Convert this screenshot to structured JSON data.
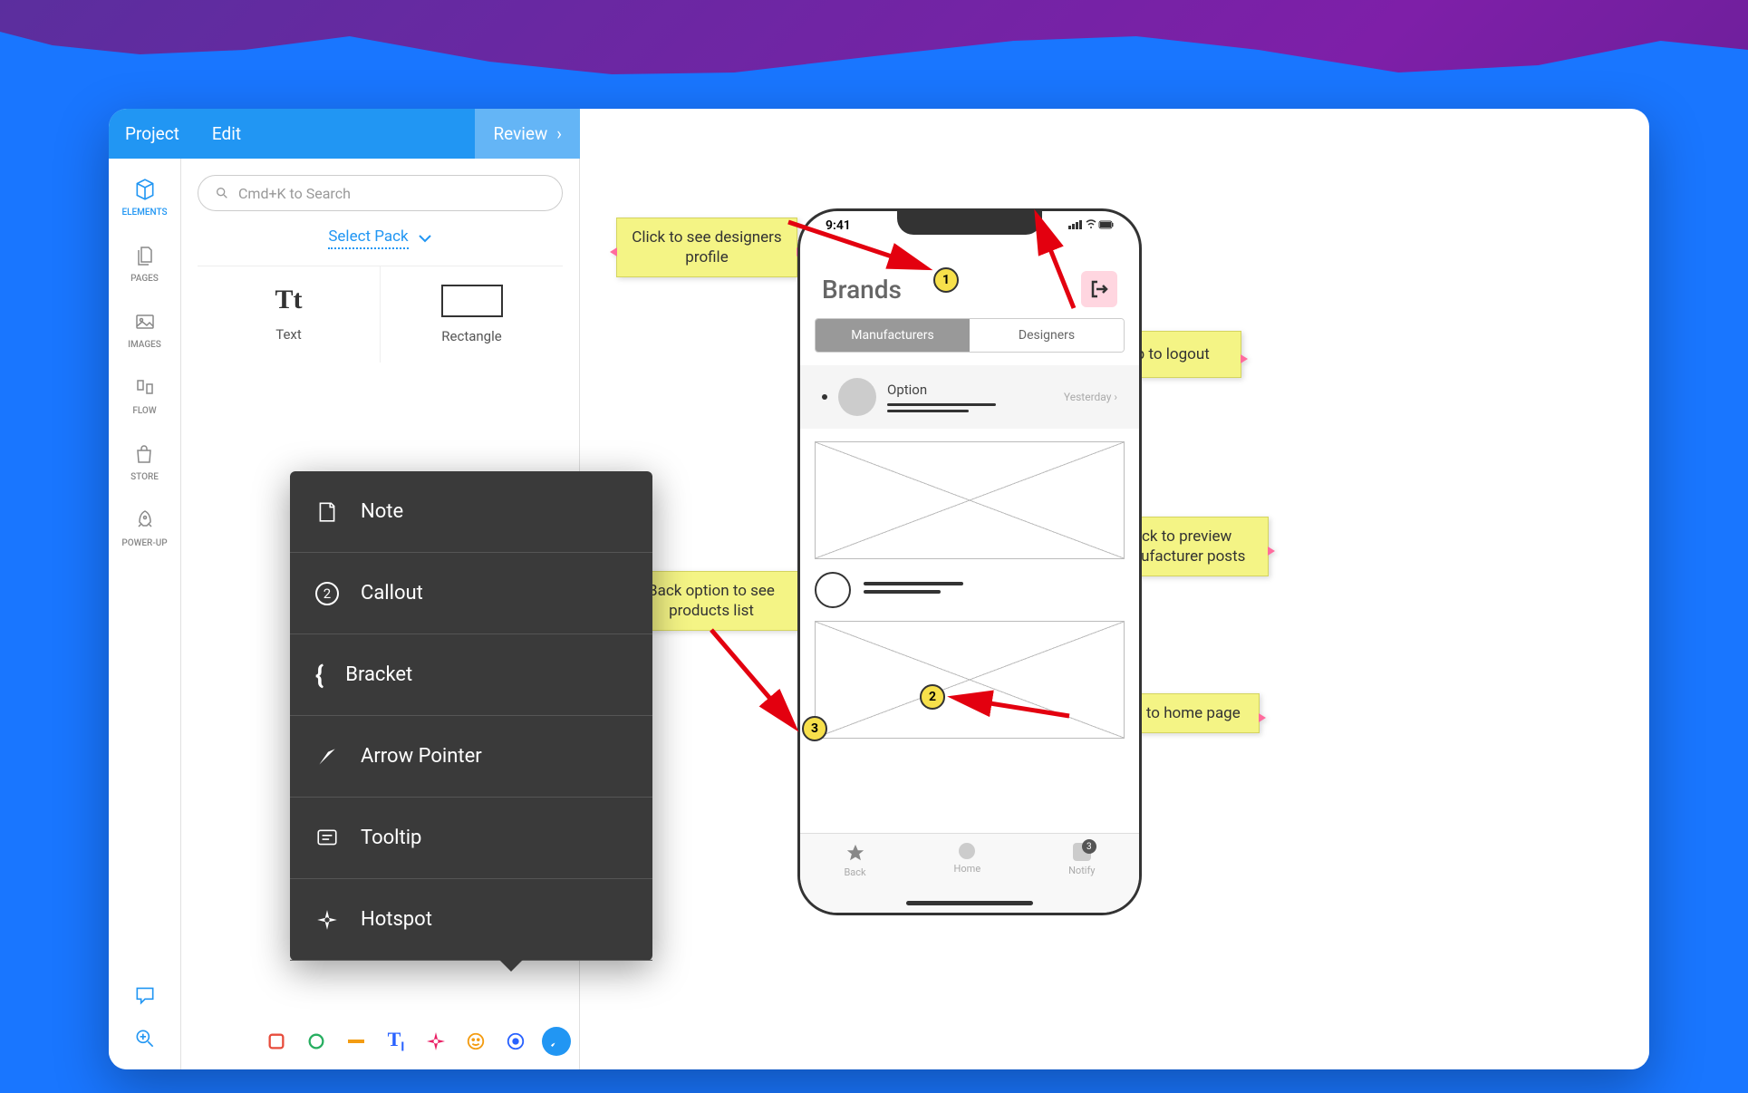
{
  "topbar": {
    "project": "Project",
    "edit": "Edit",
    "review": "Review"
  },
  "rail": {
    "elements": "ELEMENTS",
    "pages": "PAGES",
    "images": "IMAGES",
    "flow": "FLOW",
    "store": "STORE",
    "powerup": "POWER-UP"
  },
  "panel": {
    "search_placeholder": "Cmd+K to Search",
    "select_pack": "Select Pack",
    "text_label": "Text",
    "rect_label": "Rectangle",
    "text_glyph": "Tt"
  },
  "popup": {
    "note": "Note",
    "callout": "Callout",
    "bracket": "Bracket",
    "arrow": "Arrow Pointer",
    "tooltip": "Tooltip",
    "hotspot": "Hotspot",
    "callout_num": "2"
  },
  "stickies": {
    "designers": "Click to see designers profile",
    "logout": "Tap to logout",
    "back": "Back option to see products list",
    "preview": "Click to preview manufacturer posts",
    "home": "Bring to home page"
  },
  "phone": {
    "time": "9:41",
    "title": "Brands",
    "seg_manufacturers": "Manufacturers",
    "seg_designers": "Designers",
    "option": "Option",
    "yesterday": "Yesterday",
    "tab_back": "Back",
    "tab_home": "Home",
    "tab_notify": "Notify",
    "notify_badge": "3"
  },
  "callouts": {
    "c1": "1",
    "c2": "2",
    "c3": "3"
  }
}
